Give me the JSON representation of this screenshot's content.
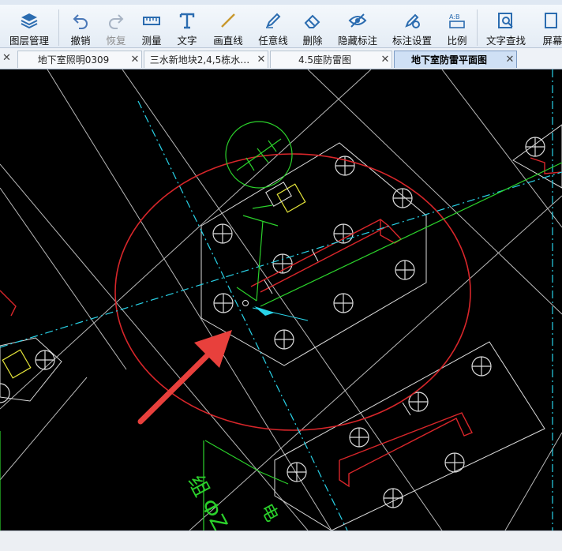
{
  "toolbar": {
    "items": [
      {
        "label": "图层管理",
        "icon": "layers-icon"
      },
      {
        "label": "撤销",
        "icon": "undo-icon"
      },
      {
        "label": "恢复",
        "icon": "redo-icon"
      },
      {
        "label": "测量",
        "icon": "ruler-icon"
      },
      {
        "label": "文字",
        "icon": "text-icon"
      },
      {
        "label": "画直线",
        "icon": "line-icon"
      },
      {
        "label": "任意线",
        "icon": "pen-icon"
      },
      {
        "label": "删除",
        "icon": "eraser-icon"
      },
      {
        "label": "隐藏标注",
        "icon": "eye-icon"
      },
      {
        "label": "标注设置",
        "icon": "annotation-settings-icon"
      },
      {
        "label": "比例",
        "icon": "scale-icon"
      },
      {
        "label": "文字查找",
        "icon": "find-text-icon"
      },
      {
        "label": "屏幕",
        "icon": "screen-icon"
      }
    ]
  },
  "tabs": [
    {
      "label": "地下室照明0309"
    },
    {
      "label": "三水新地块2,4,5栋水…"
    },
    {
      "label": "4.5座防雷图"
    },
    {
      "label": "地下室防雷平面图",
      "active": true
    }
  ],
  "cad": {
    "texts": [
      "组 ФZ",
      "电"
    ]
  },
  "colors": {
    "background": "#000000",
    "red_circle": "#d8262a",
    "arrow": "#e8403c",
    "green": "#2bd12b",
    "cyan": "#29d3e8",
    "white_lines": "#d8d8d8",
    "yellow": "#e6e63a",
    "active_tab": "#cfe0f5"
  }
}
